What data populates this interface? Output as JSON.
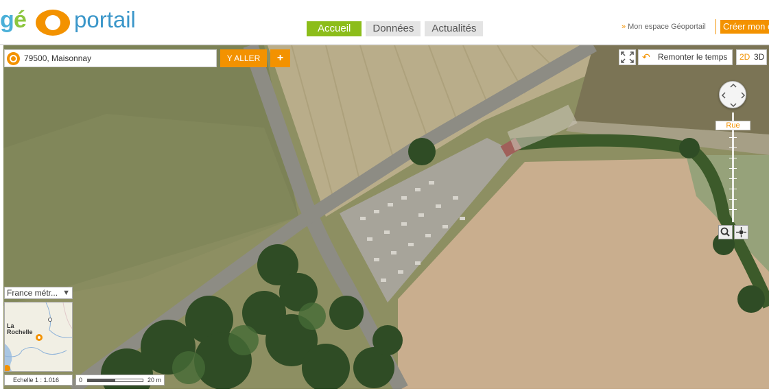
{
  "header": {
    "logo": "géOportail",
    "nav": [
      {
        "label": "Accueil",
        "active": true
      },
      {
        "label": "Données",
        "active": false
      },
      {
        "label": "Actualités",
        "active": false
      }
    ],
    "user_link": "Mon espace Géoportail",
    "create_button": "Créer mon e"
  },
  "search": {
    "value": "79500, Maisonnay",
    "go_label": "Y ALLER",
    "plus_label": "+"
  },
  "tools": {
    "time_travel_label": "Remonter le temps",
    "view_2d": "2D",
    "view_3d": "3D",
    "zoom_level_label": "Rue"
  },
  "overview": {
    "layer_select": "France métr...",
    "place_label": "La Rochelle"
  },
  "scale": {
    "ratio_text": "Echelle 1 :  1.016",
    "bar_start": "0",
    "bar_end": "20 m"
  },
  "colors": {
    "accent_orange": "#f39200",
    "nav_active_green": "#8cbd1a",
    "logo_blue": "#3a96c9"
  }
}
